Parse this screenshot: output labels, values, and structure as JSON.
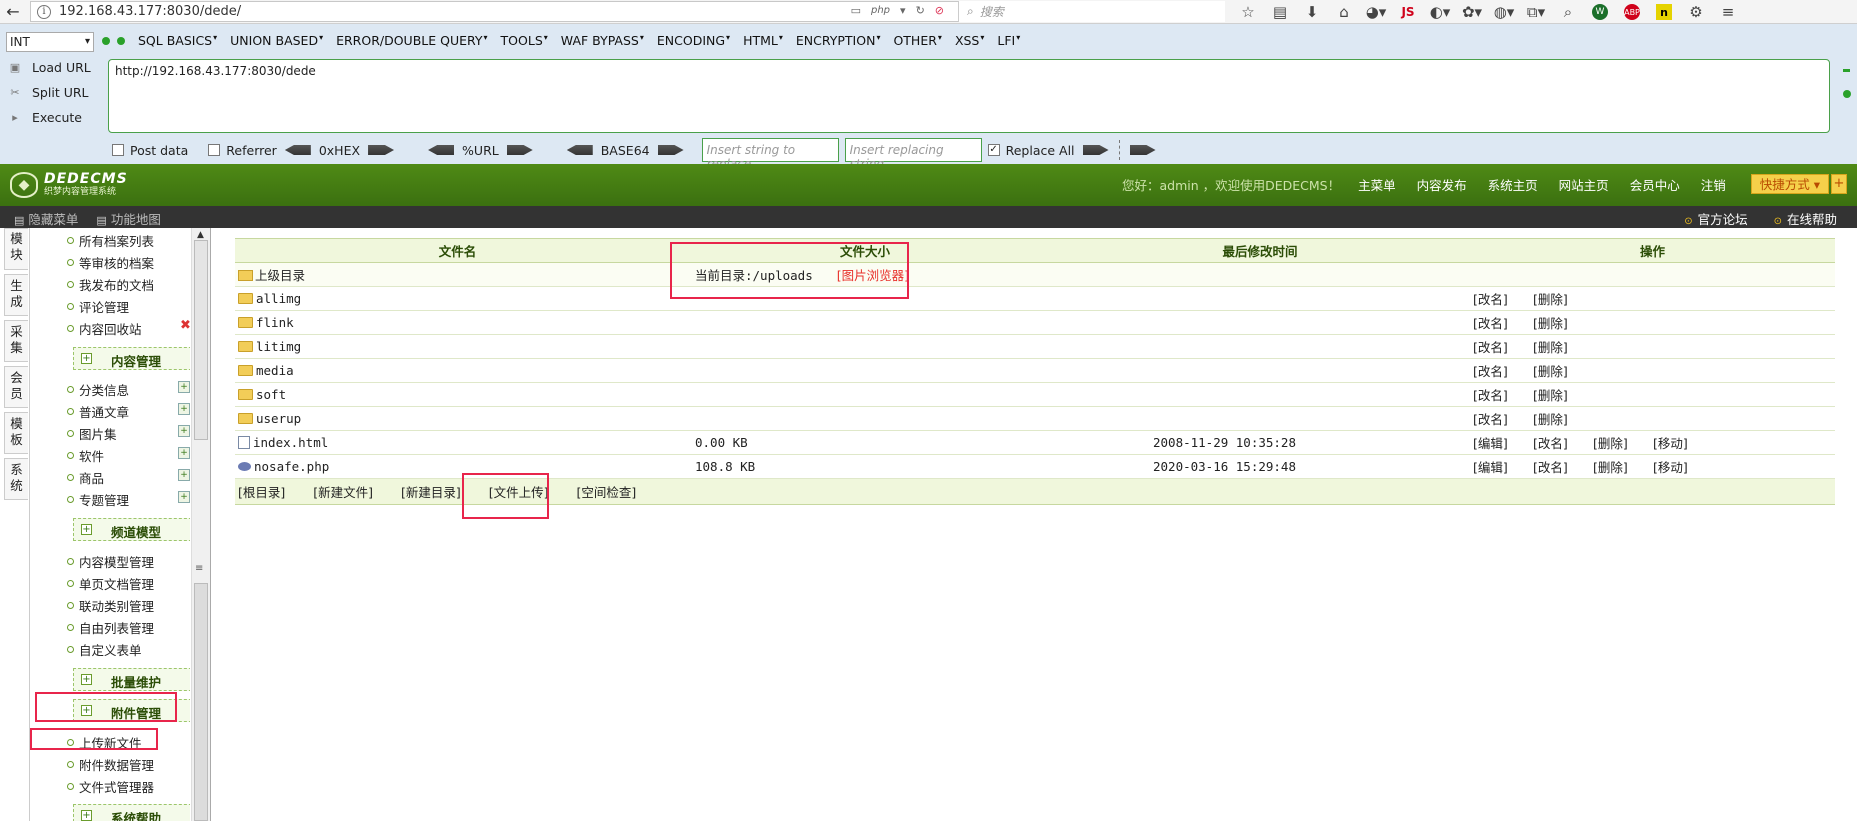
{
  "browser": {
    "url": "192.168.43.177:8030/dede/",
    "php_badge": "php",
    "search_placeholder": "搜索",
    "js_label": "JS",
    "abp_label": "ABP",
    "n_label": "n"
  },
  "hackbar": {
    "select_value": "INT",
    "menu": [
      "SQL BASICS",
      "UNION BASED",
      "ERROR/DOUBLE QUERY",
      "TOOLS",
      "WAF BYPASS",
      "ENCODING",
      "HTML",
      "ENCRYPTION",
      "OTHER",
      "XSS",
      "LFI"
    ],
    "load_url": "Load URL",
    "split_url": "Split URL",
    "execute": "Execute",
    "textarea_value": "http://192.168.43.177:8030/dede",
    "post_data": "Post data",
    "referrer": "Referrer",
    "hex": "0xHEX",
    "url_enc": "%URL",
    "base64": "BASE64",
    "replace_placeholder": "Insert string to replace",
    "replacing_placeholder": "Insert replacing string",
    "replace_all": "Replace All"
  },
  "dede": {
    "logo_title": "DEDECMS",
    "logo_subtitle": "织梦内容管理系统",
    "greeting": "您好：admin ，欢迎使用DEDECMS！",
    "nav": [
      "主菜单",
      "内容发布",
      "系统主页",
      "网站主页",
      "会员中心",
      "注销"
    ],
    "quick": "快捷方式",
    "quick_plus": "+",
    "sub_left": [
      "隐藏菜单",
      "功能地图"
    ],
    "sub_right": [
      "官方论坛",
      "在线帮助"
    ]
  },
  "left_tabs": [
    "模块",
    "生成",
    "采集",
    "会员",
    "模板",
    "系统"
  ],
  "menu": {
    "top_items": [
      "所有档案列表",
      "等审核的档案",
      "我发布的文档",
      "评论管理",
      "内容回收站"
    ],
    "group1": "内容管理",
    "group1_items": [
      "分类信息",
      "普通文章",
      "图片集",
      "软件",
      "商品",
      "专题管理"
    ],
    "group2": "频道模型",
    "group2_items": [
      "内容模型管理",
      "单页文档管理",
      "联动类别管理",
      "自由列表管理",
      "自定义表单"
    ],
    "group3": "批量维护",
    "group4": "附件管理",
    "group4_items": [
      "上传新文件",
      "附件数据管理",
      "文件式管理器"
    ],
    "group5": "系统帮助"
  },
  "table": {
    "headers": [
      "文件名",
      "文件大小",
      "最后修改时间",
      "操作"
    ],
    "parent_dir": "上级目录",
    "current_dir_label": "当前目录:/uploads",
    "image_browser": "[图片浏览器]",
    "folders": [
      "allimg",
      "flink",
      "litimg",
      "media",
      "soft",
      "userup"
    ],
    "folder_ops": [
      "[改名]",
      "[删除]"
    ],
    "files": [
      {
        "name": "index.html",
        "size": "0.00 KB",
        "time": "2008-11-29 10:35:28",
        "ops": [
          "[编辑]",
          "[改名]",
          "[删除]",
          "[移动]"
        ]
      },
      {
        "name": "nosafe.php",
        "size": "108.8 KB",
        "time": "2020-03-16 15:29:48",
        "ops": [
          "[编辑]",
          "[改名]",
          "[删除]",
          "[移动]"
        ]
      }
    ],
    "footer_links": [
      "[根目录]",
      "[新建文件]",
      "[新建目录]",
      "[文件上传]",
      "[空间检查]"
    ]
  },
  "colors": {
    "header_green": "#4a8214",
    "annotation_red": "#e8254b",
    "hackbar_bg": "#dde8f3"
  }
}
